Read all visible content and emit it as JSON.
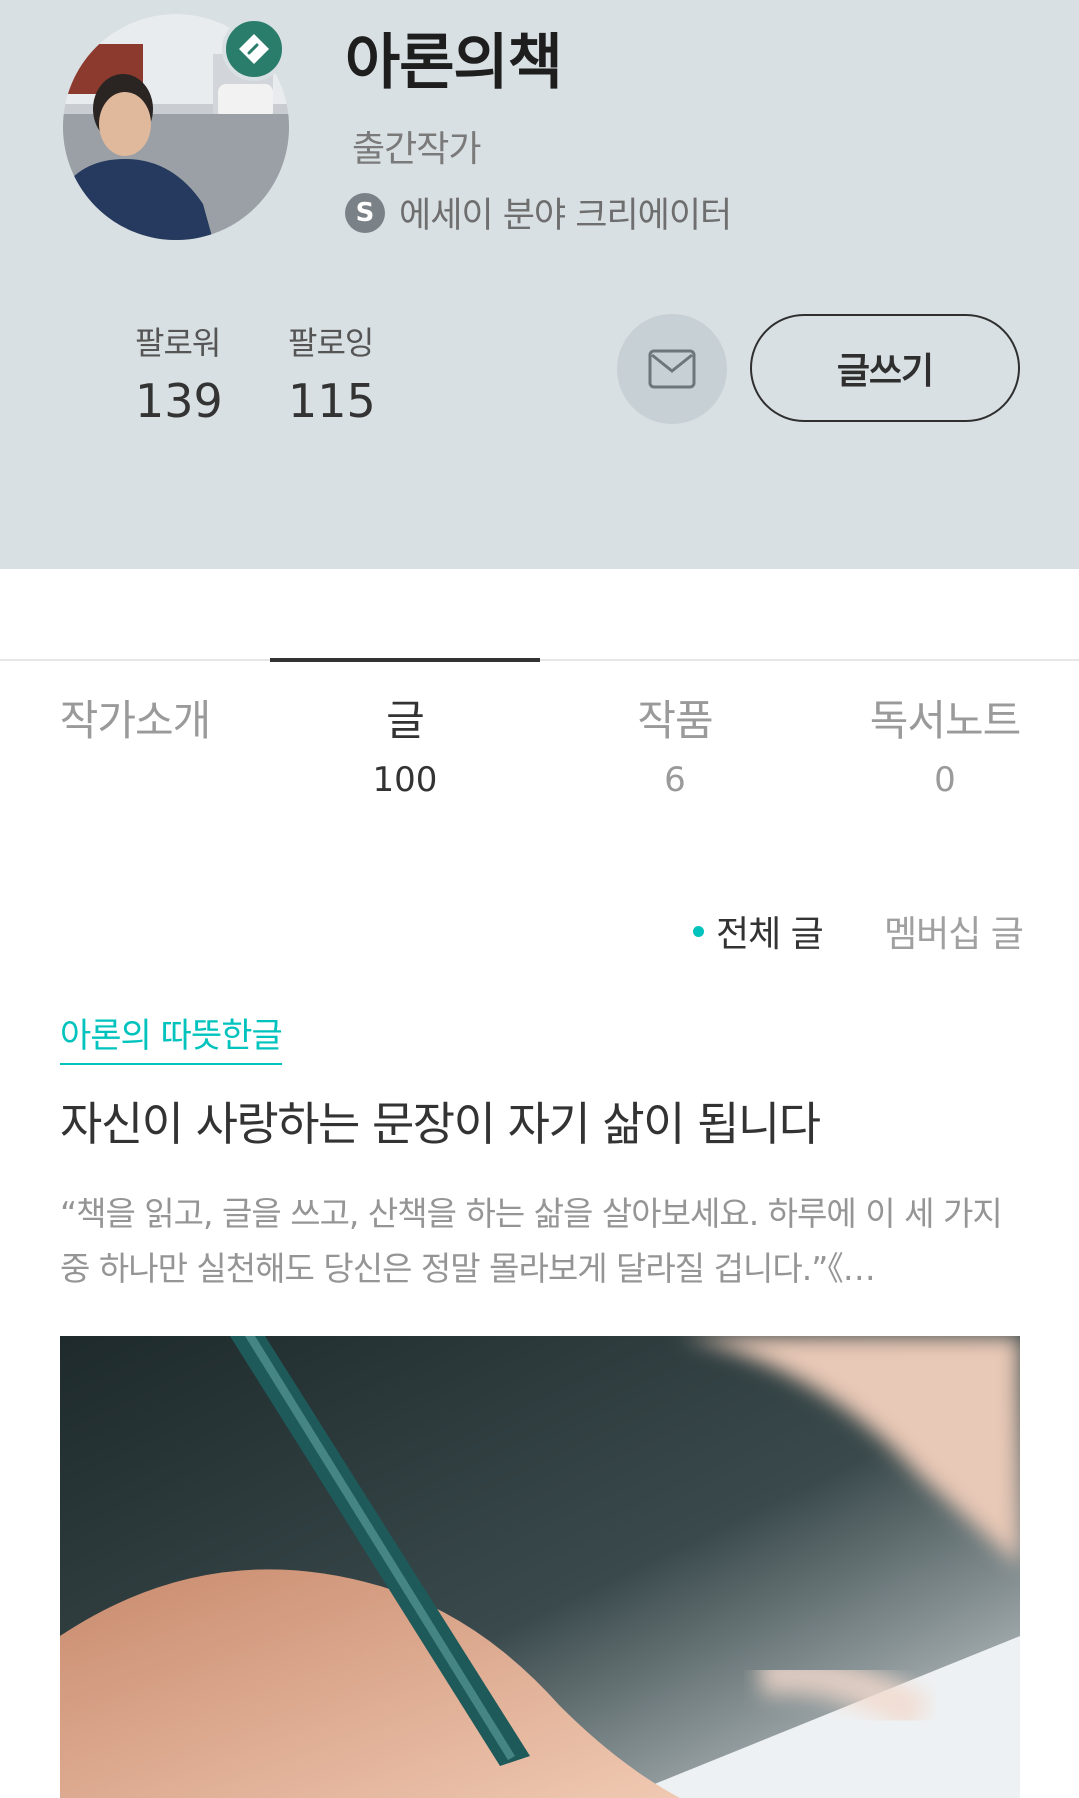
{
  "profile": {
    "name": "아론의책",
    "role": "출간작가",
    "creator_badge": "S",
    "creator_label": "에세이 분야 크리에이터",
    "avatar_icon": "avatar-photo",
    "verified_icon": "verified-badge-icon"
  },
  "stats": {
    "followers_label": "팔로워",
    "followers_value": "139",
    "following_label": "팔로잉",
    "following_value": "115"
  },
  "actions": {
    "mail_icon": "mail-icon",
    "write_label": "글쓰기"
  },
  "tabs": [
    {
      "label": "작가소개",
      "count": "",
      "active": false
    },
    {
      "label": "글",
      "count": "100",
      "active": true
    },
    {
      "label": "작품",
      "count": "6",
      "active": false
    },
    {
      "label": "독서노트",
      "count": "0",
      "active": false
    }
  ],
  "filters": {
    "all_label": "전체 글",
    "membership_label": "멤버십 글"
  },
  "post": {
    "category": "아론의 따뜻한글",
    "title": "자신이 사랑하는 문장이 자기 삶이 됩니다",
    "excerpt": "“책을 읽고, 글을 쓰고, 산책을 하는 삶을 살아보세요. 하루에 이 세 가지 중 하나만 실천해도 당신은 정말 몰라보게 달라질 겁니다.”《…"
  },
  "colors": {
    "header_bg": "#d9e0e3",
    "accent": "#00c3bd",
    "badge_green": "#2a7d6b"
  }
}
